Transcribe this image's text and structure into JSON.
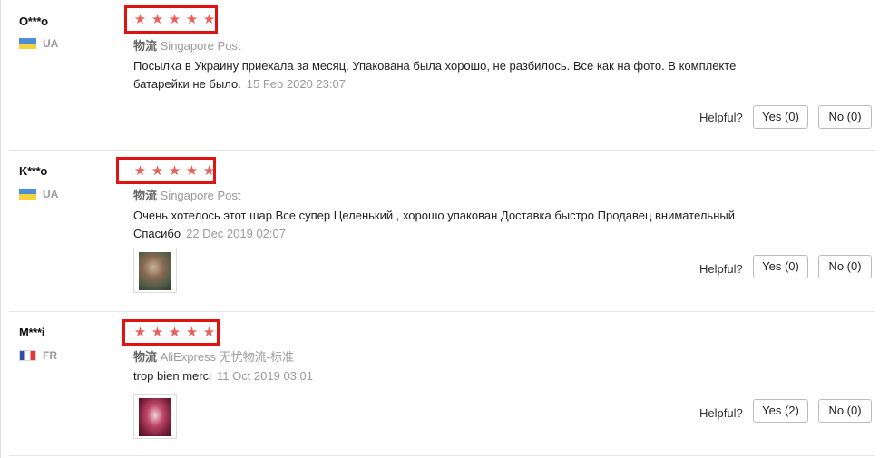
{
  "helpful_label": "Helpful?",
  "logistics_label": "物流",
  "star_glyph": "★",
  "reviews": [
    {
      "user": "O***o",
      "country": "UA",
      "rating": 5,
      "shipping": "Singapore Post",
      "text": "Посылка в Украину приехала за месяц. Упакована была хорошо, не разбилось. Все как на фото. В комплекте батарейки не было.",
      "date": "15 Feb 2020 23:07",
      "yes": "Yes (0)",
      "no": "No (0)"
    },
    {
      "user": "K***o",
      "country": "UA",
      "rating": 5,
      "shipping": "Singapore Post",
      "text": "Очень хотелось этот шар Все супер Целенький , хорошо упакован Доставка быстро Продавец внимательный Спасибо",
      "date": "22 Dec 2019 02:07",
      "yes": "Yes (0)",
      "no": "No (0)"
    },
    {
      "user": "M***i",
      "country": "FR",
      "rating": 5,
      "shipping": "AliExpress 无忧物流-标准",
      "text": "trop bien merci",
      "date": "11 Oct 2019 03:01",
      "yes": "Yes (2)",
      "no": "No (0)"
    }
  ]
}
